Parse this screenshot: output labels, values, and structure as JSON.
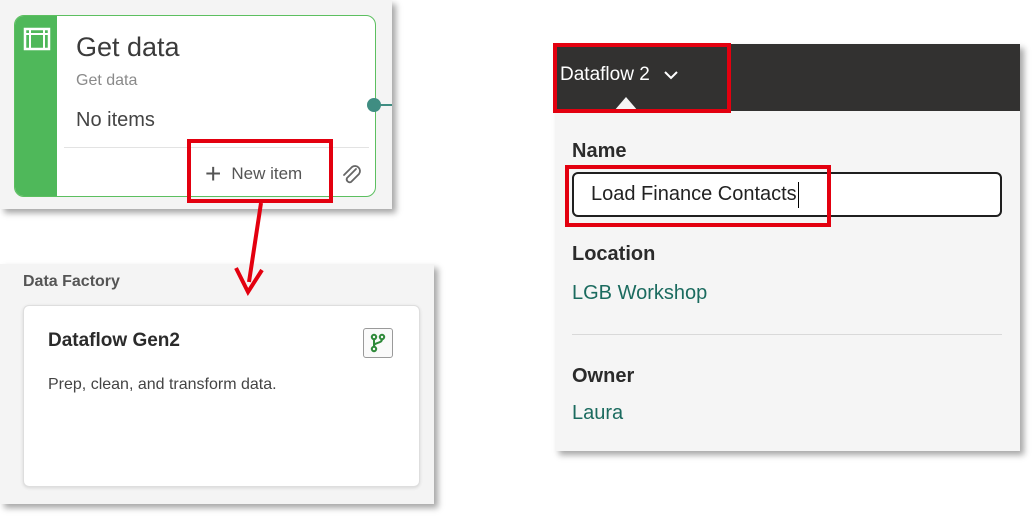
{
  "get_data_card": {
    "title": "Get data",
    "subtitle": "Get data",
    "empty_text": "No items",
    "new_item_label": "New item",
    "accent": "#4fb85a",
    "icons": [
      "table-icon",
      "plus-icon",
      "attach-icon"
    ]
  },
  "data_factory": {
    "heading": "Data Factory",
    "card_title": "Dataflow Gen2",
    "card_description": "Prep, clean, and transform data.",
    "icon": "dataflow-branch-icon"
  },
  "dataflow_panel": {
    "title": "Dataflow 2",
    "name_label": "Name",
    "name_value": "Load Finance Contacts",
    "location_label": "Location",
    "location_value": "LGB Workshop",
    "owner_label": "Owner",
    "owner_value": "Laura",
    "header_color": "#323130",
    "link_color": "#1b6b5f"
  },
  "annotation_color": "#e3000f"
}
